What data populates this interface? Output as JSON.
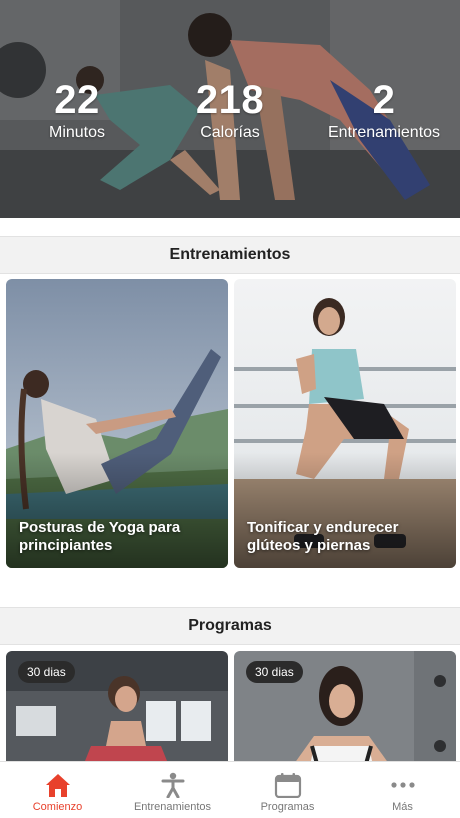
{
  "stats": [
    {
      "value": "22",
      "label": "Minutos"
    },
    {
      "value": "218",
      "label": "Calorías"
    },
    {
      "value": "2",
      "label": "Entrenamientos"
    }
  ],
  "workouts_section": {
    "title": "Entrenamientos",
    "cards": [
      {
        "title": "Posturas de Yoga para principiantes"
      },
      {
        "title": "Tonificar y endurecer glúteos y piernas"
      }
    ]
  },
  "programs_section": {
    "title": "Programas",
    "cards": [
      {
        "badge": "30 dias"
      },
      {
        "badge": "30 dias"
      }
    ]
  },
  "tabbar": {
    "active_color": "#e8412c",
    "items": [
      {
        "label": "Comienzo",
        "icon": "house-icon",
        "active": true
      },
      {
        "label": "Entrenamientos",
        "icon": "person-icon",
        "active": false
      },
      {
        "label": "Programas",
        "icon": "calendar-icon",
        "active": false
      },
      {
        "label": "Más",
        "icon": "more-dots-icon",
        "active": false
      }
    ]
  }
}
